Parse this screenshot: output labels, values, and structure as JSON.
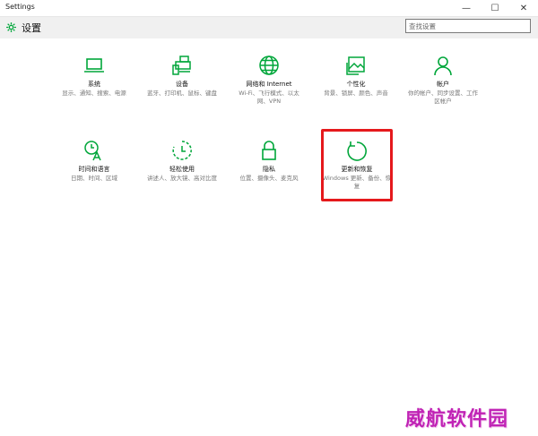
{
  "window": {
    "title": "Settings",
    "minimize": "—",
    "maximize": "☐",
    "close": "✕"
  },
  "header": {
    "title": "设置",
    "search_placeholder": "查找设置"
  },
  "tiles": [
    {
      "name": "系统",
      "desc": "显示、通知、搜索、电源",
      "icon": "laptop-icon"
    },
    {
      "name": "设备",
      "desc": "蓝牙、打印机、鼠标、键盘",
      "icon": "devices-icon"
    },
    {
      "name": "网络和 Internet",
      "desc": "Wi-Fi、飞行模式、以太网、VPN",
      "icon": "globe-icon"
    },
    {
      "name": "个性化",
      "desc": "背景、锁屏、颜色、声音",
      "icon": "personalization-icon"
    },
    {
      "name": "帐户",
      "desc": "你的帐户、同步设置、工作区帐户",
      "icon": "person-icon"
    },
    {
      "name": "时间和语言",
      "desc": "日期、时间、区域",
      "icon": "time-language-icon"
    },
    {
      "name": "轻松使用",
      "desc": "讲述人、放大镜、高对比度",
      "icon": "ease-of-access-icon"
    },
    {
      "name": "隐私",
      "desc": "位置、摄像头、麦克风",
      "icon": "lock-icon"
    },
    {
      "name": "更新和恢复",
      "desc": "Windows 更新、备份、恢复",
      "icon": "update-icon"
    }
  ],
  "watermark": "威航软件园",
  "colors": {
    "accent": "#00a63a",
    "highlight": "#e5191c",
    "watermark": "#c023b5"
  }
}
